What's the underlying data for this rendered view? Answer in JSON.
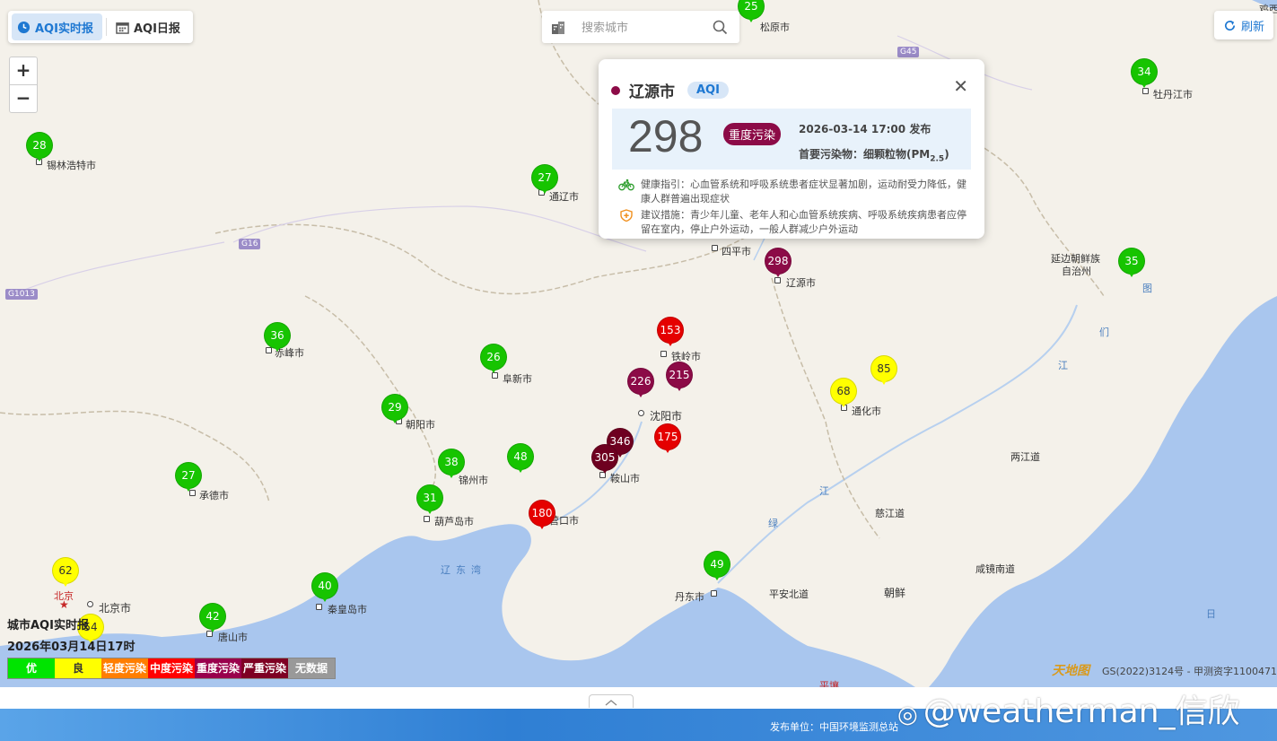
{
  "tabs": [
    {
      "label": "AQI实时报",
      "active": true,
      "icon": "clock-icon"
    },
    {
      "label": "AQI日报",
      "active": false,
      "icon": "calendar-icon"
    }
  ],
  "search": {
    "placeholder": "搜索城市",
    "icon": "search-icon"
  },
  "refresh": {
    "label": "刷新",
    "icon": "refresh-icon"
  },
  "zoom": {
    "in": "+",
    "out": "−"
  },
  "popup": {
    "city": "辽源市",
    "badge": "AQI",
    "aqi": "298",
    "level": "重度污染",
    "publish_time": "2026-03-14 17:00",
    "publish_suffix": "发布",
    "pollutant_label": "首要污染物：细颗粒物(PM",
    "pollutant_sub": "2.5",
    "pollutant_end": ")",
    "health_label": "健康指引：",
    "health_text": "心血管系统和呼吸系统患者症状显著加剧，运动耐受力降低，健康人群普遍出现症状",
    "advice_label": "建议措施：",
    "advice_text": "青少年儿童、老年人和心血管系统疾病、呼吸系统疾病患者应停留在室内，停止户外运动，一般人群减少户外运动",
    "color": "#8c0b47"
  },
  "legend": {
    "title": "城市AQI实时报",
    "time": "2026年03月14日17时",
    "items": [
      {
        "label": "优",
        "color": "#00e400"
      },
      {
        "label": "良",
        "color": "#ffff00"
      },
      {
        "label": "轻度污染",
        "color": "#ff7e00"
      },
      {
        "label": "中度污染",
        "color": "#ff0000"
      },
      {
        "label": "重度污染",
        "color": "#99004c"
      },
      {
        "label": "严重污染",
        "color": "#7e0023"
      },
      {
        "label": "无数据",
        "color": "#999999"
      }
    ]
  },
  "markers": [
    {
      "value": "25",
      "color": "#17c400"
    },
    {
      "value": "34",
      "color": "#17c400"
    },
    {
      "value": "28",
      "color": "#17c400"
    },
    {
      "value": "27",
      "color": "#17c400"
    },
    {
      "value": "298",
      "color": "#8c0b47"
    },
    {
      "value": "35",
      "color": "#17c400"
    },
    {
      "value": "36",
      "color": "#17c400"
    },
    {
      "value": "153",
      "color": "#e50000"
    },
    {
      "value": "26",
      "color": "#17c400"
    },
    {
      "value": "215",
      "color": "#8c0b47"
    },
    {
      "value": "226",
      "color": "#8c0b47"
    },
    {
      "value": "85",
      "color": "#ffff00"
    },
    {
      "value": "68",
      "color": "#ffff00"
    },
    {
      "value": "29",
      "color": "#17c400"
    },
    {
      "value": "346",
      "color": "#6e0020"
    },
    {
      "value": "175",
      "color": "#e50000"
    },
    {
      "value": "305",
      "color": "#6e0020"
    },
    {
      "value": "38",
      "color": "#17c400"
    },
    {
      "value": "48",
      "color": "#17c400"
    },
    {
      "value": "27",
      "color": "#17c400"
    },
    {
      "value": "31",
      "color": "#17c400"
    },
    {
      "value": "180",
      "color": "#e50000"
    },
    {
      "value": "49",
      "color": "#17c400"
    },
    {
      "value": "62",
      "color": "#ffff00"
    },
    {
      "value": "40",
      "color": "#17c400"
    },
    {
      "value": "42",
      "color": "#17c400"
    },
    {
      "value": "54",
      "color": "#ffff00"
    }
  ],
  "places": [
    "松原市",
    "牡丹江市",
    "锡林浩特市",
    "通辽市",
    "四平市",
    "辽源市",
    "延边朝鲜族",
    "自治州",
    "赤峰市",
    "铁岭市",
    "阜新市",
    "沈阳市",
    "通化市",
    "朝阳市",
    "鞍山市",
    "锦州市",
    "承德市",
    "葫芦岛市",
    "营口市",
    "丹东市",
    "两江道",
    "慈江道",
    "平安北道",
    "朝鲜",
    "咸镜南道",
    "北京",
    "北京市",
    "秦皇岛市",
    "唐山市",
    "辽东湾",
    "图",
    "们",
    "江",
    "江",
    "绿",
    "日",
    "平壤",
    "鸡西"
  ],
  "roads": [
    "G16",
    "G1013",
    "G45"
  ],
  "copyright": "GS(2022)3124号 - 甲测资字1100471",
  "map_brand": "天地图",
  "publisher": "发布单位：中国环境监测总站",
  "watermark": "@weatherman_信欣"
}
